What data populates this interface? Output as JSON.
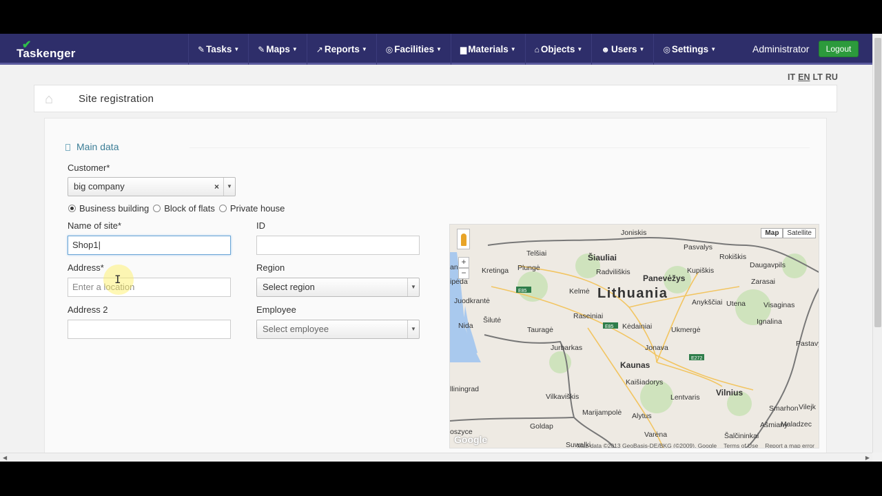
{
  "navbar": {
    "brand": "Taskenger",
    "items": [
      {
        "icon": "edit-icon",
        "glyph": "✎",
        "label": "Tasks"
      },
      {
        "icon": "edit-icon",
        "glyph": "✎",
        "label": "Maps"
      },
      {
        "icon": "chart-icon",
        "glyph": "↗",
        "label": "Reports"
      },
      {
        "icon": "circle-icon",
        "glyph": "◎",
        "label": "Facilities"
      },
      {
        "icon": "truck-icon",
        "glyph": "▆",
        "label": "Materials"
      },
      {
        "icon": "home-icon",
        "glyph": "⌂",
        "label": "Objects"
      },
      {
        "icon": "users-icon",
        "glyph": "☻",
        "label": "Users"
      },
      {
        "icon": "gear-icon",
        "glyph": "◎",
        "label": "Settings"
      }
    ],
    "user": "Administrator",
    "logout": "Logout"
  },
  "languages": [
    "IT",
    "EN",
    "LT",
    "RU"
  ],
  "active_language": "EN",
  "page": {
    "title": "Site registration"
  },
  "form": {
    "section": "Main data",
    "customer_label": "Customer*",
    "customer_value": "big company",
    "building_types": [
      {
        "label": "Business building",
        "checked": true
      },
      {
        "label": "Block of flats",
        "checked": false
      },
      {
        "label": "Private house",
        "checked": false
      }
    ],
    "name_label": "Name of site*",
    "name_value": "Shop1",
    "id_label": "ID",
    "id_value": "",
    "address_label": "Address*",
    "address_placeholder": "Enter a location",
    "region_label": "Region",
    "region_value": "Select region",
    "address2_label": "Address 2",
    "address2_value": "",
    "employee_label": "Employee",
    "employee_value": "Select employee"
  },
  "map": {
    "type_buttons": [
      "Map",
      "Satellite"
    ],
    "country": "Lithuania",
    "cities": [
      "Joniskis",
      "Pasvalys",
      "Telšiai",
      "Šiauliai",
      "Rokiškis",
      "Kretinga",
      "Plungė",
      "Radviliškis",
      "Kupiškis",
      "Daugavpils",
      "Zarasai",
      "Panevėžys",
      "ipėda",
      "Kelmė",
      "Juodkrantė",
      "Anykščiai",
      "Utena",
      "Visaginas",
      "Raseiniai",
      "Nida",
      "Šilutė",
      "Tauragė",
      "Kėdainiai",
      "Ukmergė",
      "Ignalina",
      "Jurbarkas",
      "Jonava",
      "Pastavy",
      "Kaunas",
      "Kaišiadorys",
      "lliningrad",
      "Vilnius",
      "Vilkaviškis",
      "Lentvaris",
      "Marijampolė",
      "Alytus",
      "Smarhon",
      "Vilejk",
      "Goldap",
      "Varėna",
      "Šalčininkai",
      "Ašmiany",
      "Maladzec",
      "oszyce",
      "Suwalki",
      "an"
    ],
    "road_labels": [
      "E85",
      "E85",
      "E272"
    ],
    "logo": "Google",
    "footer": [
      "Map data ©2013 GeoBasis-DE/BKG (©2009), Google",
      "Terms of Use",
      "Report a map error"
    ]
  }
}
